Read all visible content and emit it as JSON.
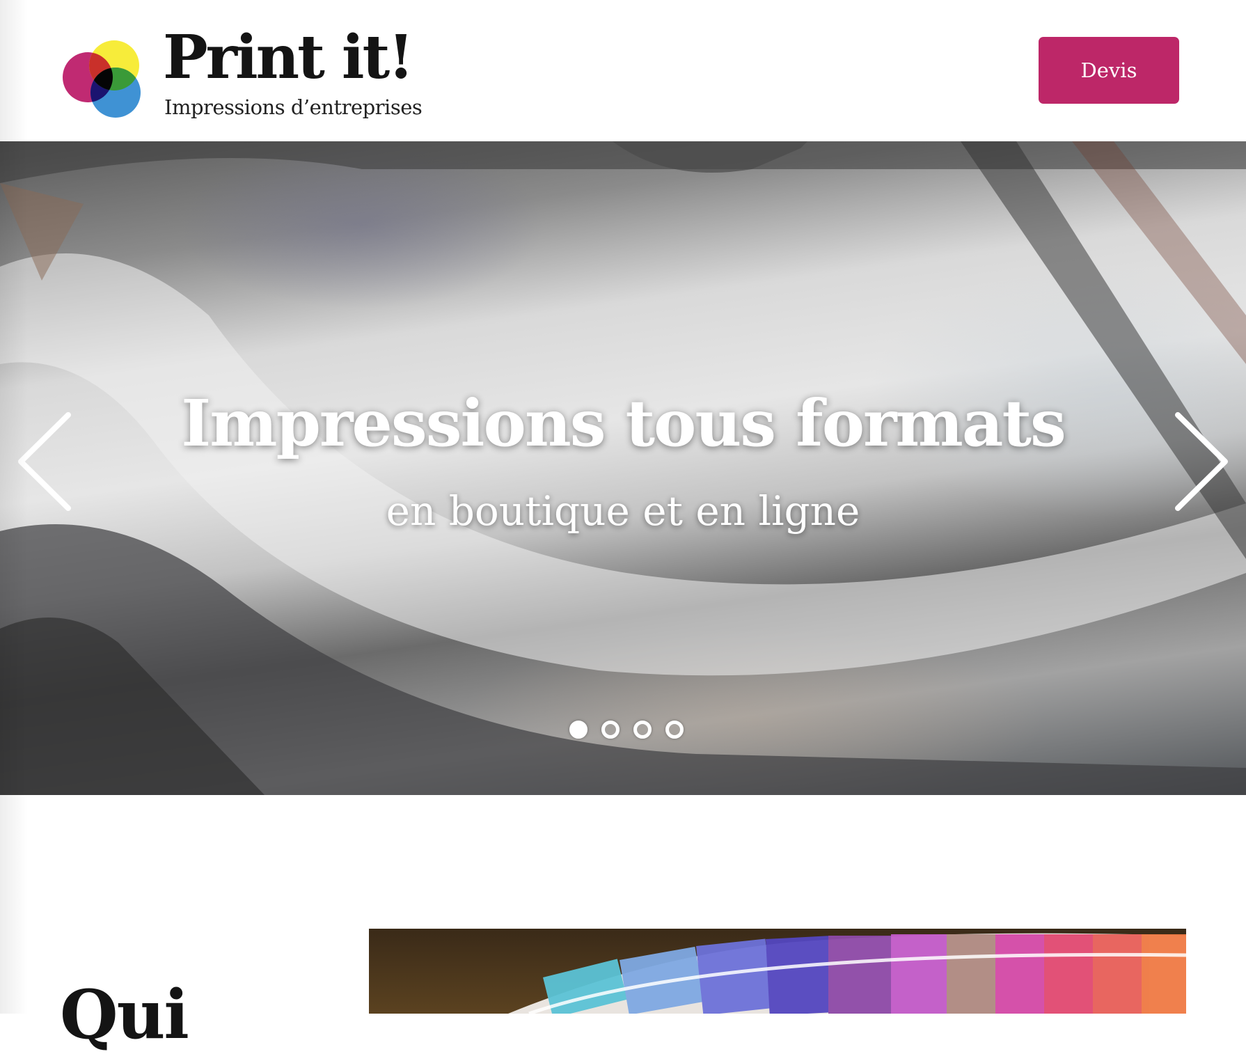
{
  "header": {
    "logo_title": "Print it!",
    "logo_tagline": "Impressions d’entreprises",
    "quote_button_label": "Devis",
    "accent_color": "#bd2768"
  },
  "hero": {
    "title": "Impressions tous formats",
    "subtitle": "en boutique et en ligne",
    "slide_count": 4,
    "active_slide": 1
  },
  "about": {
    "heading": "Qui"
  },
  "icons": {
    "logo": "overlapping-cmy-circles-logo",
    "prev": "chevron-left-icon",
    "next": "chevron-right-icon"
  }
}
